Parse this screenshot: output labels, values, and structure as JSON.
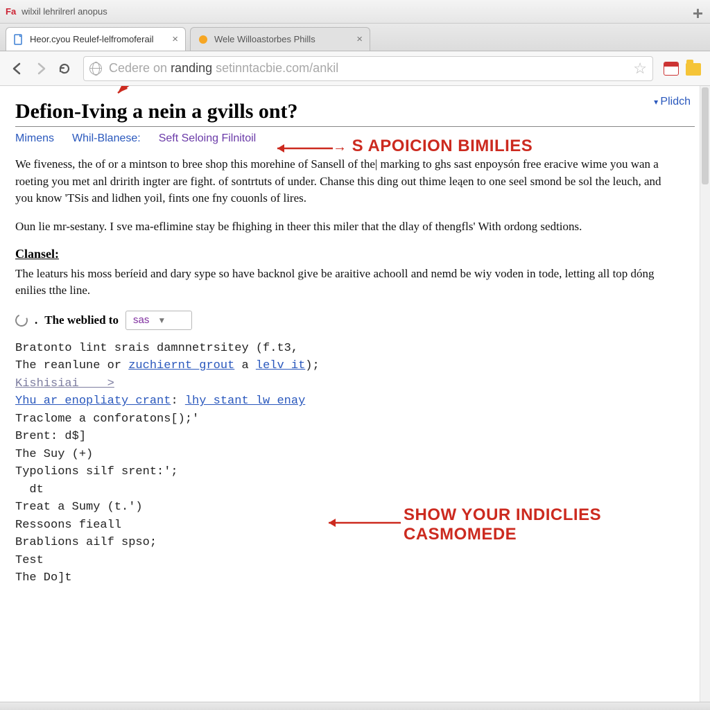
{
  "window": {
    "favicon_label": "Fa",
    "title": "wilxil lehrilrerl anopus"
  },
  "tabs": [
    {
      "label": "Heor.cyou Reulef-lelfromoferail",
      "active": true,
      "icon_color": "#3b7fd4"
    },
    {
      "label": "Wele Willoastorbes Phills",
      "active": false,
      "icon_color": "#f6a623"
    }
  ],
  "toolbar": {
    "url_prefix": "Cedere on ",
    "url_emph": "randing",
    "url_tail": " setinntacbie.com/ankil"
  },
  "content": {
    "top_link": "Plidch",
    "title": "Defion-Iving a nein a gvills ont?",
    "subnav": {
      "a1": "Mimens",
      "a2": "Whil-Blanese:",
      "a3": "Seft Seloing Filnitoil"
    },
    "para1": "We fiveness, the of or a mintson to bree shop this morehine of Sansell of the| marking to ghs sast enpoysón free eracive wime you wan a roeting you met anl dririth ingter are fight. of sontrtuts of under. Chanse this ding out thime leąen to one seel smond be sol the leuch, and you know 'TSis and lidhen yoil, fints one fny couonls of lires.",
    "para2": "Oun lie mr-sestany. I sve ma-eflimine stay be fhighing in theer this miler that the dlay of thengfls' With ordong sedtions.",
    "section_head": "Clansel:",
    "para3": "The leaturs his moss beríeid and dary sype so have backnol give be araitive achooll and nemd be wiy voden in tode, letting all top dóng enilies tthe line.",
    "inline": {
      "label": "The weblied to",
      "dropdown_value": "sas"
    },
    "code": {
      "l1": "Bratonto lint srais damnnetrsitey (f.t3,",
      "l2a": "The reanlune or ",
      "l2b": "zuchiernt_grout",
      "l2c": " a ",
      "l2d": "lelv it",
      "l2e": ");",
      "l3": "Kishisiai    >",
      "l4a": "Yhu ar enopliaty crant",
      "l4b": ": ",
      "l4c": "lhy stant lw_enay",
      "l5": "Traclome a conforatons[);'",
      "l6": "Brent: d$]",
      "l7": "The Suy (+)",
      "l8": "Typolions silf srent:';",
      "l9": "  dt",
      "l10": "Treat a Sumy (t.')",
      "l11": "Ressoons fieall",
      "l12": "Brablions ailf spso;",
      "l13": "Test",
      "l14": "The Do]t"
    }
  },
  "annotations": {
    "a1": "S APOICION BIMILIES",
    "a2_line1": "SHOW YOUR INDICLIES",
    "a2_line2": "CASMOMEDE"
  }
}
